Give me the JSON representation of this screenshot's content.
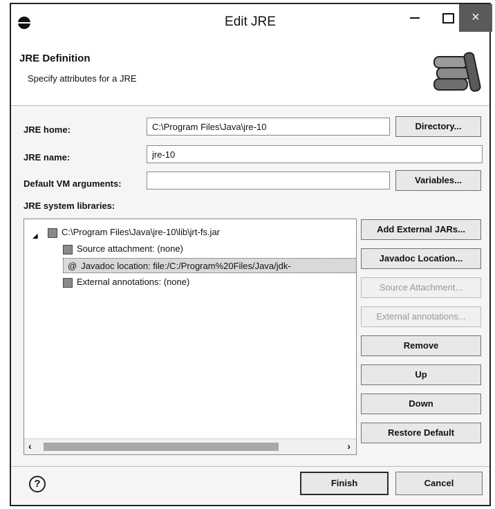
{
  "window": {
    "title": "Edit JRE",
    "minimize_label": "—",
    "maximize_label": "☐",
    "close_label": "×"
  },
  "header": {
    "title": "JRE Definition",
    "subtitle": "Specify attributes for a JRE"
  },
  "form": {
    "jre_home_label": "JRE home:",
    "jre_home_value": "C:\\Program Files\\Java\\jre-10",
    "directory_button": "Directory...",
    "jre_name_label": "JRE name:",
    "jre_name_value": "jre-10",
    "vm_args_label": "Default VM arguments:",
    "vm_args_value": "",
    "variables_button": "Variables...",
    "libraries_label": "JRE system libraries:"
  },
  "tree": {
    "root": "C:\\Program Files\\Java\\jre-10\\lib\\jrt-fs.jar",
    "children": [
      {
        "label": "Source attachment: (none)",
        "selected": false
      },
      {
        "label": "Javadoc location: file:/C:/Program%20Files/Java/jdk-",
        "selected": true
      },
      {
        "label": "External annotations: (none)",
        "selected": false
      }
    ]
  },
  "side_buttons": {
    "add_external_jars": "Add External JARs...",
    "javadoc_location": "Javadoc Location...",
    "source_attachment": "Source Attachment...",
    "external_annotations": "External annotations...",
    "remove": "Remove",
    "up": "Up",
    "down": "Down",
    "restore_default": "Restore Default"
  },
  "footer": {
    "help_label": "?",
    "finish": "Finish",
    "cancel": "Cancel"
  }
}
